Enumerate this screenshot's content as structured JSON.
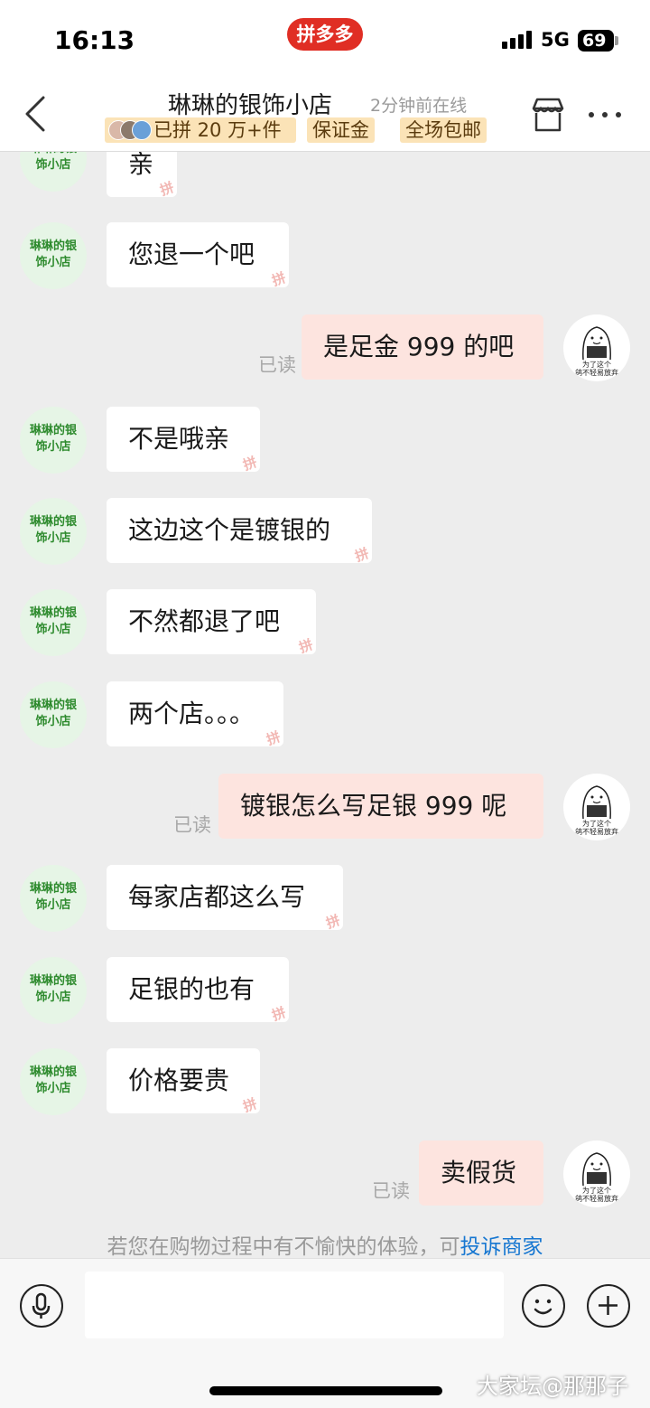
{
  "status_bar": {
    "time": "16:13",
    "app_pill": "拼多多",
    "network": "5G",
    "battery": "69"
  },
  "header": {
    "shop_name": "琳琳的银饰小店",
    "online_status": "2分钟前在线",
    "badges": [
      "已拼 20 万+件",
      "保证金",
      "全场包邮"
    ]
  },
  "shop_avatar_text": [
    "琳琳的银",
    "饰小店"
  ],
  "my_avatar_caption": [
    "为了这个",
    "鸽不轻易放弃"
  ],
  "bubble_stamp": "拼",
  "read_label": "已读",
  "messages": [
    {
      "from": "shop",
      "text": "亲"
    },
    {
      "from": "shop",
      "text": "您退一个吧"
    },
    {
      "from": "me",
      "text": "是足金 999 的吧"
    },
    {
      "from": "shop",
      "text": "不是哦亲"
    },
    {
      "from": "shop",
      "text": "这边这个是镀银的"
    },
    {
      "from": "shop",
      "text": "不然都退了吧"
    },
    {
      "from": "shop",
      "text": "两个店。。。"
    },
    {
      "from": "me",
      "text": "镀银怎么写足银 999 呢"
    },
    {
      "from": "shop",
      "text": "每家店都这么写"
    },
    {
      "from": "shop",
      "text": "足银的也有"
    },
    {
      "from": "shop",
      "text": "价格要贵"
    },
    {
      "from": "me",
      "text": "卖假货"
    }
  ],
  "notice": {
    "text": "若您在购物过程中有不愉快的体验，可",
    "link": "投诉商家"
  },
  "icons": {
    "back": "chevron-left-icon",
    "store": "store-icon",
    "more": "more-icon",
    "mic": "mic-icon",
    "emoji": "emoji-icon",
    "plus": "plus-icon"
  },
  "colors": {
    "pdd_red": "#e02e24",
    "badge_bg": "#fbe3b7",
    "outgoing_bubble": "#fde4df",
    "link": "#1777d1",
    "shop_avatar_green": "#2e8b2e"
  },
  "watermark": "大家坛@那那子"
}
